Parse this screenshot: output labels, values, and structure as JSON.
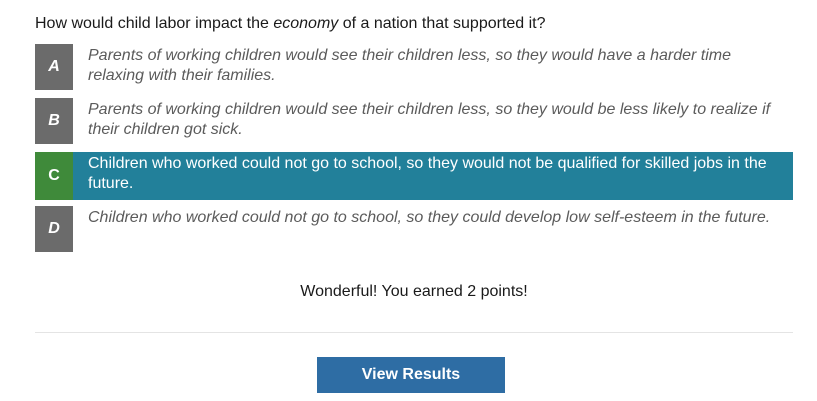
{
  "question": {
    "before": "How would child labor impact the ",
    "emphasis": "economy",
    "after": " of a nation that supported it?"
  },
  "answers": [
    {
      "letter": "A",
      "text": "Parents of working children would see their children less, so they would have a harder time relaxing with their families.",
      "selected": false
    },
    {
      "letter": "B",
      "text": "Parents of working children would see their children less, so they would be less likely to realize if their children got sick.",
      "selected": false
    },
    {
      "letter": "C",
      "text": "Children who worked could not go to school, so they would not be qualified for skilled jobs in the future.",
      "selected": true
    },
    {
      "letter": "D",
      "text": "Children who worked could not go to school, so they could develop low self-esteem in the future.",
      "selected": false
    }
  ],
  "feedback": "Wonderful! You earned 2 points!",
  "view_results_label": "View Results",
  "colors": {
    "selected_row": "#22809a",
    "correct_badge": "#3f8a3a",
    "letter_badge": "#6b6b6b",
    "button": "#2e6da4"
  }
}
